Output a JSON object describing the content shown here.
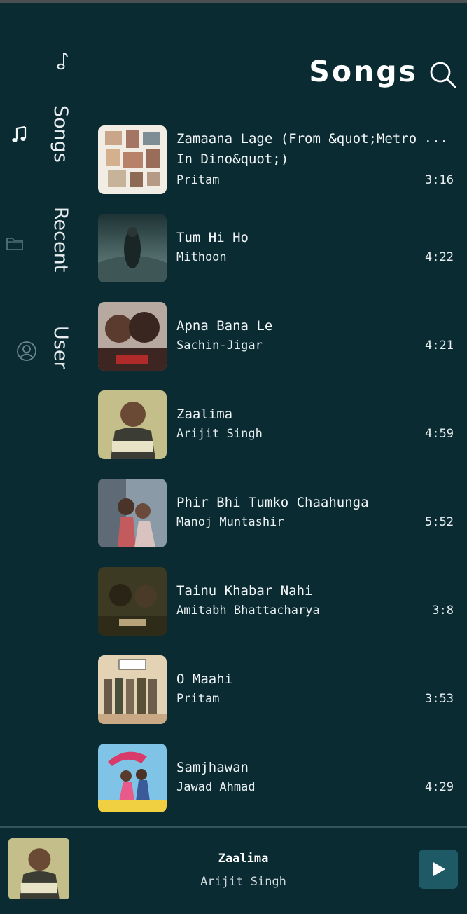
{
  "sidebar": {
    "items": [
      {
        "label": "Songs",
        "icon": "music-notes-icon"
      },
      {
        "label": "Recent",
        "icon": "folder-icon"
      },
      {
        "label": "User",
        "icon": "user-icon"
      }
    ],
    "logo_icon": "music-note-icon"
  },
  "header": {
    "title": "Songs",
    "search_icon": "search-icon"
  },
  "songs": [
    {
      "title": "Zamaana Lage (From &quot;Metro In Dino&quot;)",
      "artist": "Pritam",
      "duration": "3:16",
      "overflow": "..."
    },
    {
      "title": "Tum Hi Ho",
      "artist": "Mithoon",
      "duration": "4:22"
    },
    {
      "title": "Apna Bana Le",
      "artist": "Sachin-Jigar",
      "duration": "4:21"
    },
    {
      "title": "Zaalima",
      "artist": "Arijit Singh",
      "duration": "4:59"
    },
    {
      "title": "Phir Bhi Tumko Chaahunga",
      "artist": "Manoj Muntashir",
      "duration": "5:52"
    },
    {
      "title": "Tainu Khabar Nahi",
      "artist": "Amitabh Bhattacharya",
      "duration": "3:8"
    },
    {
      "title": "O Maahi",
      "artist": "Pritam",
      "duration": "3:53"
    },
    {
      "title": "Samjhawan",
      "artist": "Jawad Ahmad",
      "duration": "4:29"
    }
  ],
  "now_playing": {
    "title": "Zaalima",
    "artist": "Arijit Singh",
    "play_icon": "play-icon"
  },
  "colors": {
    "background": "#0b2b33",
    "play_button": "#1d5a66",
    "text": "#eef3f4"
  }
}
